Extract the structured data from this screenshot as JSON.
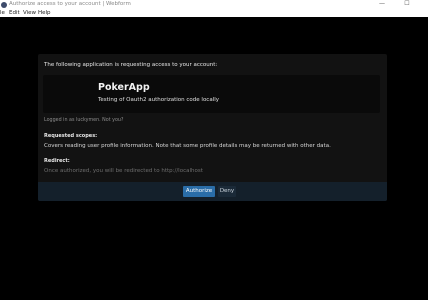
{
  "window": {
    "title": "Authorize access to your account | Webform",
    "minimize_glyph": "—",
    "maximize_glyph": "☐"
  },
  "menu": {
    "items": [
      "le",
      "Edit",
      "View",
      "Help"
    ]
  },
  "dialog": {
    "intro": "The following application is requesting access to your account:",
    "app_name": "PokerApp",
    "app_description": "Testing of Oauth2 authorization code locally",
    "logged_in_text": "Logged in as luckymen.",
    "not_you_link": "Not you?",
    "scopes_title": "Requested scopes:",
    "scopes_text": "Covers reading user profile information. Note that some profile details may be returned with other data.",
    "redirect_title": "Redirect:",
    "redirect_text": "Once authorized, you will be redirected to http://localhost",
    "authorize_label": "Authorize",
    "deny_label": "Deny"
  },
  "colors": {
    "background": "#000000",
    "dialog": "#121212",
    "footer": "#14202b",
    "primary_button": "#2a6da8"
  }
}
